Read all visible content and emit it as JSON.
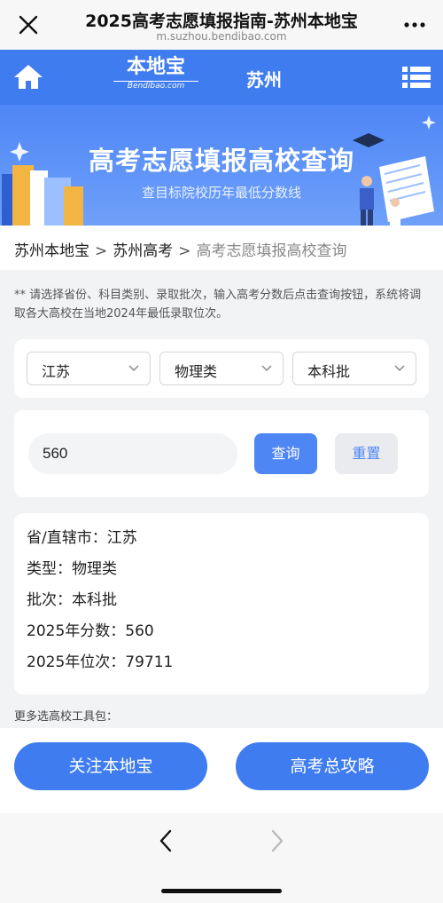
{
  "browser": {
    "title": "2025高考志愿填报指南-苏州本地宝",
    "url": "m.suzhou.bendibao.com"
  },
  "nav": {
    "logo_main": "本地宝",
    "logo_sub": "Bendibao.com",
    "city": "苏州"
  },
  "banner": {
    "title": "高考志愿填报高校查询",
    "subtitle": "查目标院校历年最低分数线"
  },
  "breadcrumb": {
    "items": [
      "苏州本地宝",
      "苏州高考"
    ],
    "current": "高考志愿填报高校查询",
    "separator": ">"
  },
  "note": "** 请选择省份、科目类别、录取批次，输入高考分数后点击查询按钮，系统将调取各大高校在当地2024年最低录取位次。",
  "selects": {
    "province": "江苏",
    "subject": "物理类",
    "batch": "本科批"
  },
  "score_input": {
    "value": "560"
  },
  "buttons": {
    "query": "查询",
    "reset": "重置",
    "follow": "关注本地宝",
    "guide": "高考总攻略"
  },
  "result": [
    "省/直辖市：江苏",
    "类型：物理类",
    "批次：本科批",
    "2025年分数：560",
    "2025年位次：79711"
  ],
  "tools_label": "更多选高校工具包：",
  "colors": {
    "brand_blue": "#3f7cf0",
    "button_blue": "#4f86f6",
    "page_bg": "#f2f3f5"
  },
  "icons": {
    "close": "close-icon",
    "more": "more-icon",
    "home": "home-icon",
    "menu": "menu-icon",
    "back": "chevron-left-icon",
    "forward": "chevron-right-icon"
  }
}
